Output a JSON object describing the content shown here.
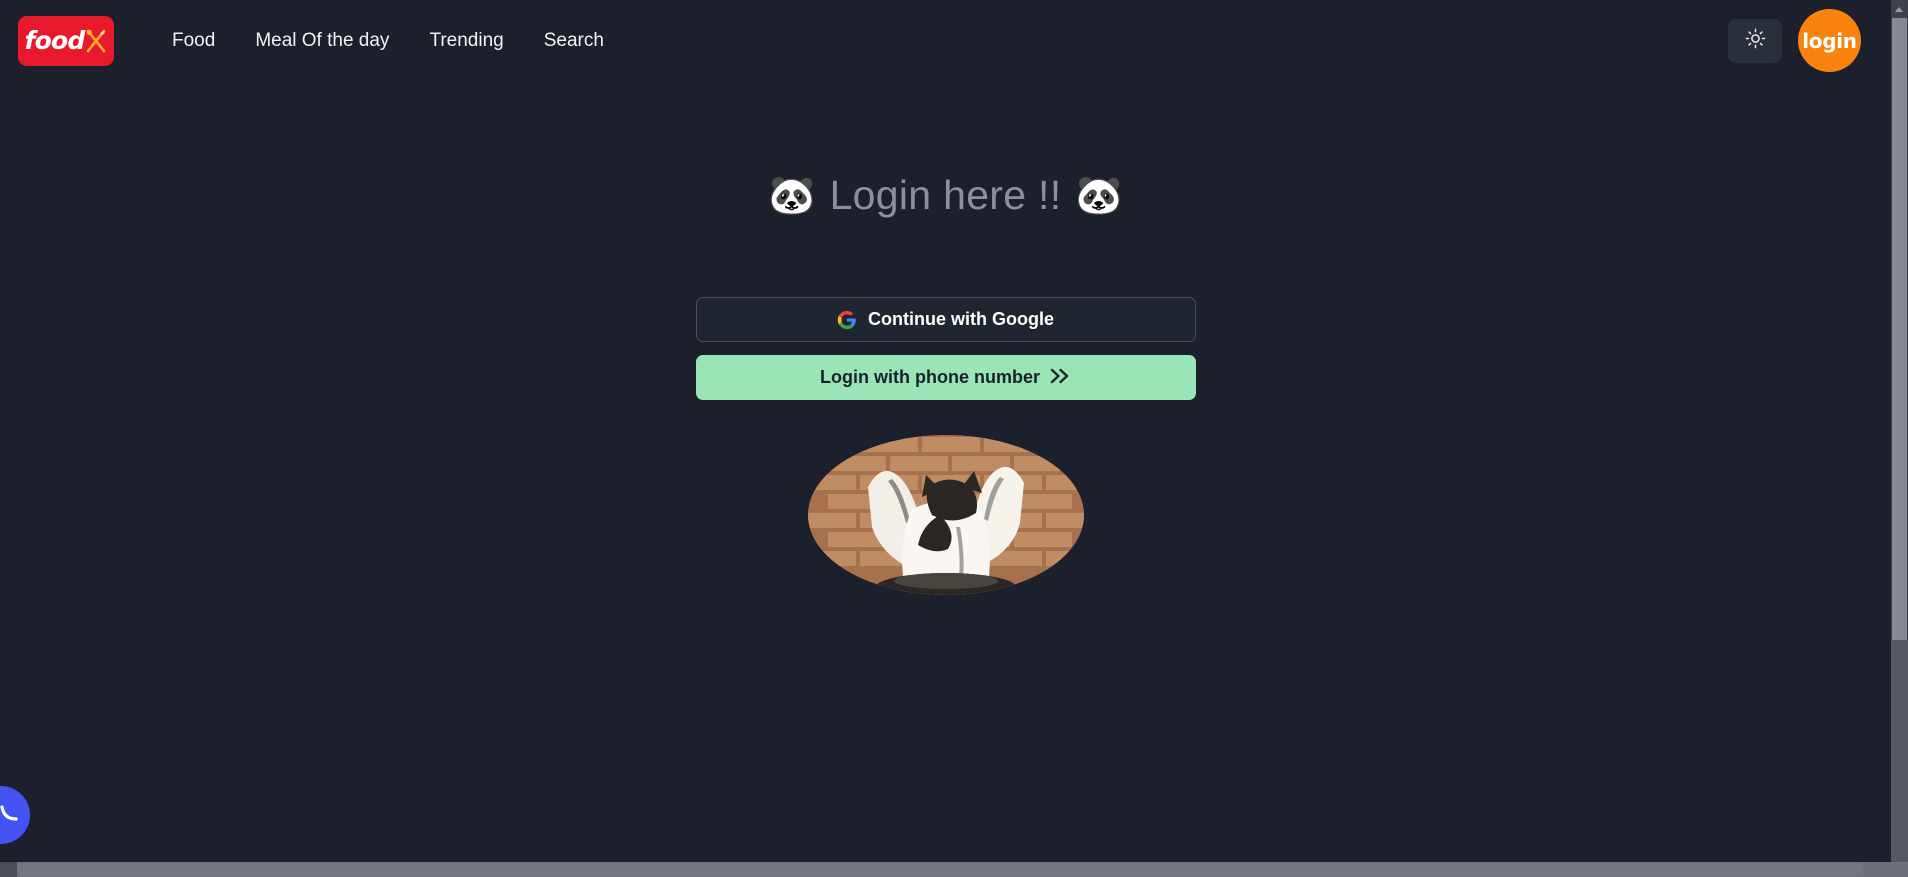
{
  "page": {
    "background_color": "#1b202c",
    "accent_green": "#9ae5b5",
    "accent_orange": "#f8840f",
    "brand_red": "#e8192c"
  },
  "navbar": {
    "logo": {
      "word": "food",
      "mark": "x-fork-spoon",
      "background_color": "#e8192c"
    },
    "links": [
      {
        "label": "Food",
        "name": "nav-link-food"
      },
      {
        "label": "Meal Of the day",
        "name": "nav-link-meal-of-the-day"
      },
      {
        "label": "Trending",
        "name": "nav-link-trending"
      },
      {
        "label": "Search",
        "name": "nav-link-search"
      }
    ],
    "theme_toggle": {
      "icon": "sun-icon",
      "label": "Toggle light mode"
    },
    "login_button": {
      "label": "login",
      "color": "#f8840f"
    }
  },
  "main": {
    "title": {
      "left_emoji": "🐼",
      "text": "Login here !!",
      "right_emoji": "🐼",
      "color": "#8b9099"
    },
    "google_button": {
      "label": "Continue with Google",
      "icon": "google-g-icon"
    },
    "phone_button": {
      "label": "Login with phone number",
      "icon": "double-chevron-right-icon",
      "background_color": "#9ae5b5"
    },
    "cat_image": {
      "alt": "cat raising arms in front of brick wall"
    }
  },
  "chat_widget": {
    "icon": "smile-chat-icon",
    "color": "#4353f4"
  },
  "scrollbars": {
    "vertical_visible": "true",
    "horizontal_visible": "true"
  }
}
